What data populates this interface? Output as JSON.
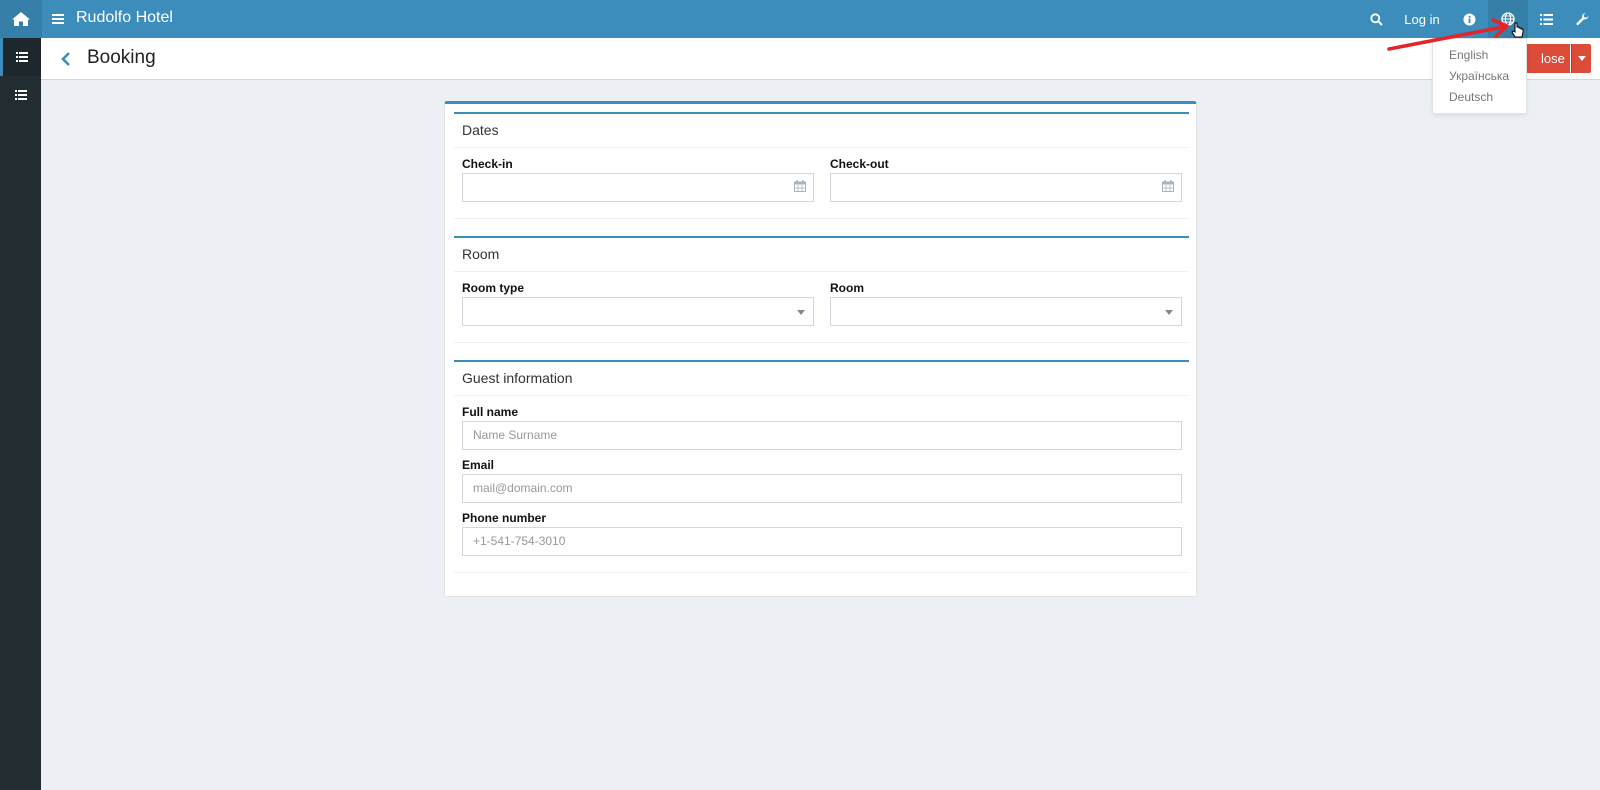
{
  "app": {
    "brand": "Rudolfo Hotel"
  },
  "topbar": {
    "login_label": "Log in",
    "icons": [
      "home-icon",
      "hamburger-icon",
      "search-icon",
      "info-icon",
      "globe-icon",
      "list-icon",
      "wrench-icon"
    ]
  },
  "sidebar": {
    "icons": [
      "list-icon",
      "list-icon"
    ]
  },
  "header": {
    "title": "Booking",
    "close_label": "lose"
  },
  "language_menu": {
    "items": [
      "English",
      "Українська",
      "Deutsch"
    ]
  },
  "form": {
    "dates": {
      "title": "Dates",
      "checkin_label": "Check-in",
      "checkout_label": "Check-out",
      "checkin_value": "",
      "checkout_value": ""
    },
    "room": {
      "title": "Room",
      "room_type_label": "Room type",
      "room_label": "Room",
      "room_type_value": "",
      "room_value": ""
    },
    "guest": {
      "title": "Guest information",
      "fullname_label": "Full name",
      "fullname_placeholder": "Name Surname",
      "email_label": "Email",
      "email_placeholder": "mail@domain.com",
      "phone_label": "Phone number",
      "phone_placeholder": "+1-541-754-3010"
    }
  },
  "colors": {
    "topbar": "#3c8dbc",
    "topbar_dark": "#367fa9",
    "sidebar": "#222d32",
    "background": "#ecf0f5",
    "danger": "#dd4b39",
    "annotation_arrow": "#e52329"
  }
}
